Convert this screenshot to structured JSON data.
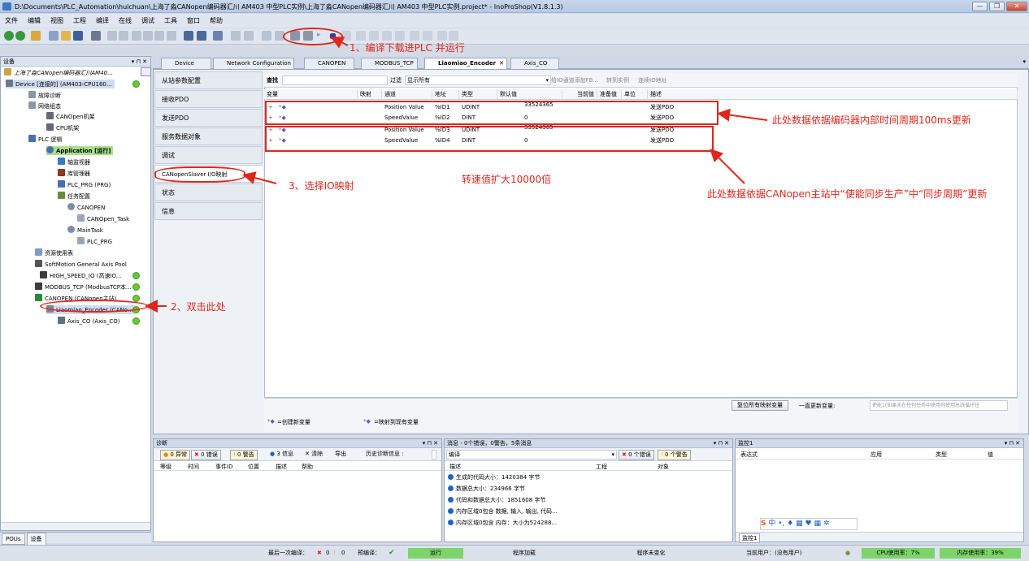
{
  "window": {
    "title": "D:\\Documents\\PLC_Automation\\huichuan\\上海了淼CANopen编码器汇川 AM403 中型PLC实例\\上海了淼CANopen编码器汇川 AM403 中型PLC实例.project* - InoProShop(V1.8.1.3)"
  },
  "menu": [
    "文件",
    "编辑",
    "视图",
    "工程",
    "编译",
    "在线",
    "调试",
    "工具",
    "窗口",
    "帮助"
  ],
  "left_panel": {
    "title": "设备",
    "tabs": {
      "pous": "POUs",
      "devices": "设备"
    },
    "tree": [
      "上海了淼CANopen编码器汇川AM40...",
      "Device [连接的] (AM403-CPU160...",
      "故障诊断",
      "网络组态",
      "CANOpen机架",
      "CPU机架",
      "PLC 逻辑",
      "Application [运行]",
      "轴监视器",
      "库管理器",
      "PLC_PRG (PRG)",
      "任务配置",
      "CANOPEN",
      "CANOpen_Task",
      "MainTask",
      "PLC_PRG",
      "资源使用表",
      "SoftMotion General Axis Pool",
      "HIGH_SPEED_IO (高速IO...",
      "MODBUS_TCP (ModbusTCP本...",
      "CANOPEN (CANopen主站)",
      "Liaomiao_Encoder (CANo...",
      "Axis_CO (Axis_CO)"
    ]
  },
  "doc_tabs": [
    "Device",
    "Network Configuration",
    "CANOPEN",
    "MODBUS_TCP",
    "Liaomiao_Encoder",
    "Axis_CO"
  ],
  "side_nav": [
    "从站参数配置",
    "接收PDO",
    "发送PDO",
    "服务数据对象",
    "调试",
    "CANopenSlaver I/O映射",
    "状态",
    "信息"
  ],
  "filter": {
    "find_label": "查找",
    "filter_label": "过滤",
    "filter_value": "显示所有",
    "add_fb": "给IO通道添加FB...",
    "goto_instance": "转到实例",
    "link_addr": "连续IO地址"
  },
  "grid": {
    "headers": [
      "变量",
      "映射",
      "通道",
      "地址",
      "类型",
      "默认值",
      "当前值",
      "准备值",
      "单位",
      "描述"
    ],
    "rows": [
      {
        "channel": "Position Value",
        "address": "%ID1",
        "type": "UDINT",
        "default": "33524365",
        "desc": "发送PDO"
      },
      {
        "channel": "SpeedValue",
        "address": "%ID2",
        "type": "DINT",
        "default": "0",
        "desc": "发送PDO"
      },
      {
        "channel": "Position Value",
        "address": "%ID3",
        "type": "UDINT",
        "default": "33524365",
        "desc": "发送PDO"
      },
      {
        "channel": "SpeedValue",
        "address": "%ID4",
        "type": "DINT",
        "default": "0",
        "desc": "发送PDO"
      }
    ]
  },
  "editor_footer": {
    "reset_btn": "复位所有映射变量",
    "update_label": "一直更新变量:",
    "update_value": "使能1(如果未在任何任务中使用则使用总线循环任",
    "legend_new": "=创建新变量",
    "legend_map": "=映射到现有变量"
  },
  "diag_panel": {
    "title": "诊断",
    "buttons": {
      "errors": "0 异常",
      "err2": "0 错误",
      "warn": "0 警告",
      "info": "3 信息",
      "clear": "清除",
      "export": "导出",
      "history": "历史诊断信息 :"
    },
    "columns": [
      "等级",
      "时间",
      "事件ID",
      "位置",
      "描述",
      "帮助"
    ]
  },
  "msg_panel": {
    "title": "消息 - 0个错误，0警告，5条消息",
    "source": "编译",
    "err_btn": "0 个错误",
    "warn_btn": "0 个警告",
    "columns": [
      "描述",
      "工程",
      "对象"
    ],
    "messages": [
      "生成的代码大小：1420384 字节",
      "数据总大小：234966 字节",
      "代码和数据总大小：1851608 字节",
      "内存区域0包含 数据, 输入, 输出, 代码...",
      "内存区域0包含 内存：大小为524288..."
    ]
  },
  "watch_panel": {
    "title": "监控1",
    "columns": [
      "表达式",
      "应用",
      "类型",
      "值"
    ],
    "tab": "监控1"
  },
  "status": {
    "last_compile": "最后一次编译：",
    "last_err": "0",
    "last_warn": "0",
    "precompile": "预编译：",
    "run": "运行",
    "program_loaded": "程序加载",
    "program_unchanged": "程序未变化",
    "user": "当前用户：(没有用户)",
    "cpu": "CPU使用率：7%",
    "mem": "内存使用率：39%"
  },
  "annotations": {
    "a1": "1、编译下载进PLC 并运行",
    "a2": "2、双击此处",
    "a3": "3、选择IO映射",
    "a4": "此处数据依据编码器内部时间周期100ms更新",
    "a5": "转速值扩大10000倍",
    "a6": "此处数据依据CANopen主站中“使能同步生产”中“同步周期”更新"
  },
  "colors": {
    "annotation": "#e0261b",
    "status_run": "#7ed46a",
    "check_green": "#6ec43c",
    "info_blue": "#1f63c6"
  }
}
